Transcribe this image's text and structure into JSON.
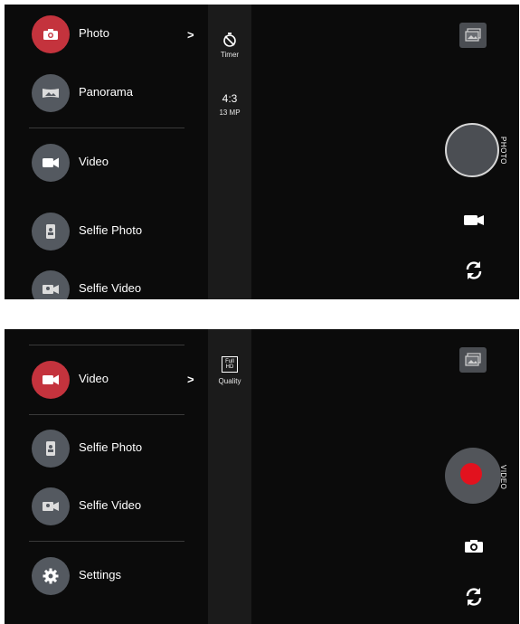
{
  "screen_photo": {
    "menu": [
      {
        "label": "Photo",
        "icon": "camera-icon",
        "active": true
      },
      {
        "label": "Panorama",
        "icon": "panorama-icon",
        "active": false
      },
      {
        "label": "Video",
        "icon": "video-camera-icon",
        "active": false
      },
      {
        "label": "Selfie Photo",
        "icon": "selfie-photo-icon",
        "active": false
      },
      {
        "label": "Selfie Video",
        "icon": "selfie-video-icon",
        "active": false
      }
    ],
    "chevron": ">",
    "settings_strip": {
      "timer_icon": "timer-icon",
      "timer_label": "Timer",
      "ratio": "4:3",
      "resolution": "13 MP"
    },
    "mode_label": "PHOTO"
  },
  "screen_video": {
    "menu": [
      {
        "label": "Video",
        "icon": "video-camera-icon",
        "active": true
      },
      {
        "label": "Selfie Photo",
        "icon": "selfie-photo-icon",
        "active": false
      },
      {
        "label": "Selfie Video",
        "icon": "selfie-video-icon",
        "active": false
      },
      {
        "label": "Settings",
        "icon": "gear-icon",
        "active": false
      }
    ],
    "chevron": ">",
    "settings_strip": {
      "quality_icon_text": "Full HD",
      "quality_label": "Quality"
    },
    "mode_label": "VIDEO"
  },
  "colors": {
    "active_accent": "#c4333d",
    "record_red": "#e2121e",
    "panel_bg": "#0b0b0b",
    "circle_gray": "#545960"
  }
}
